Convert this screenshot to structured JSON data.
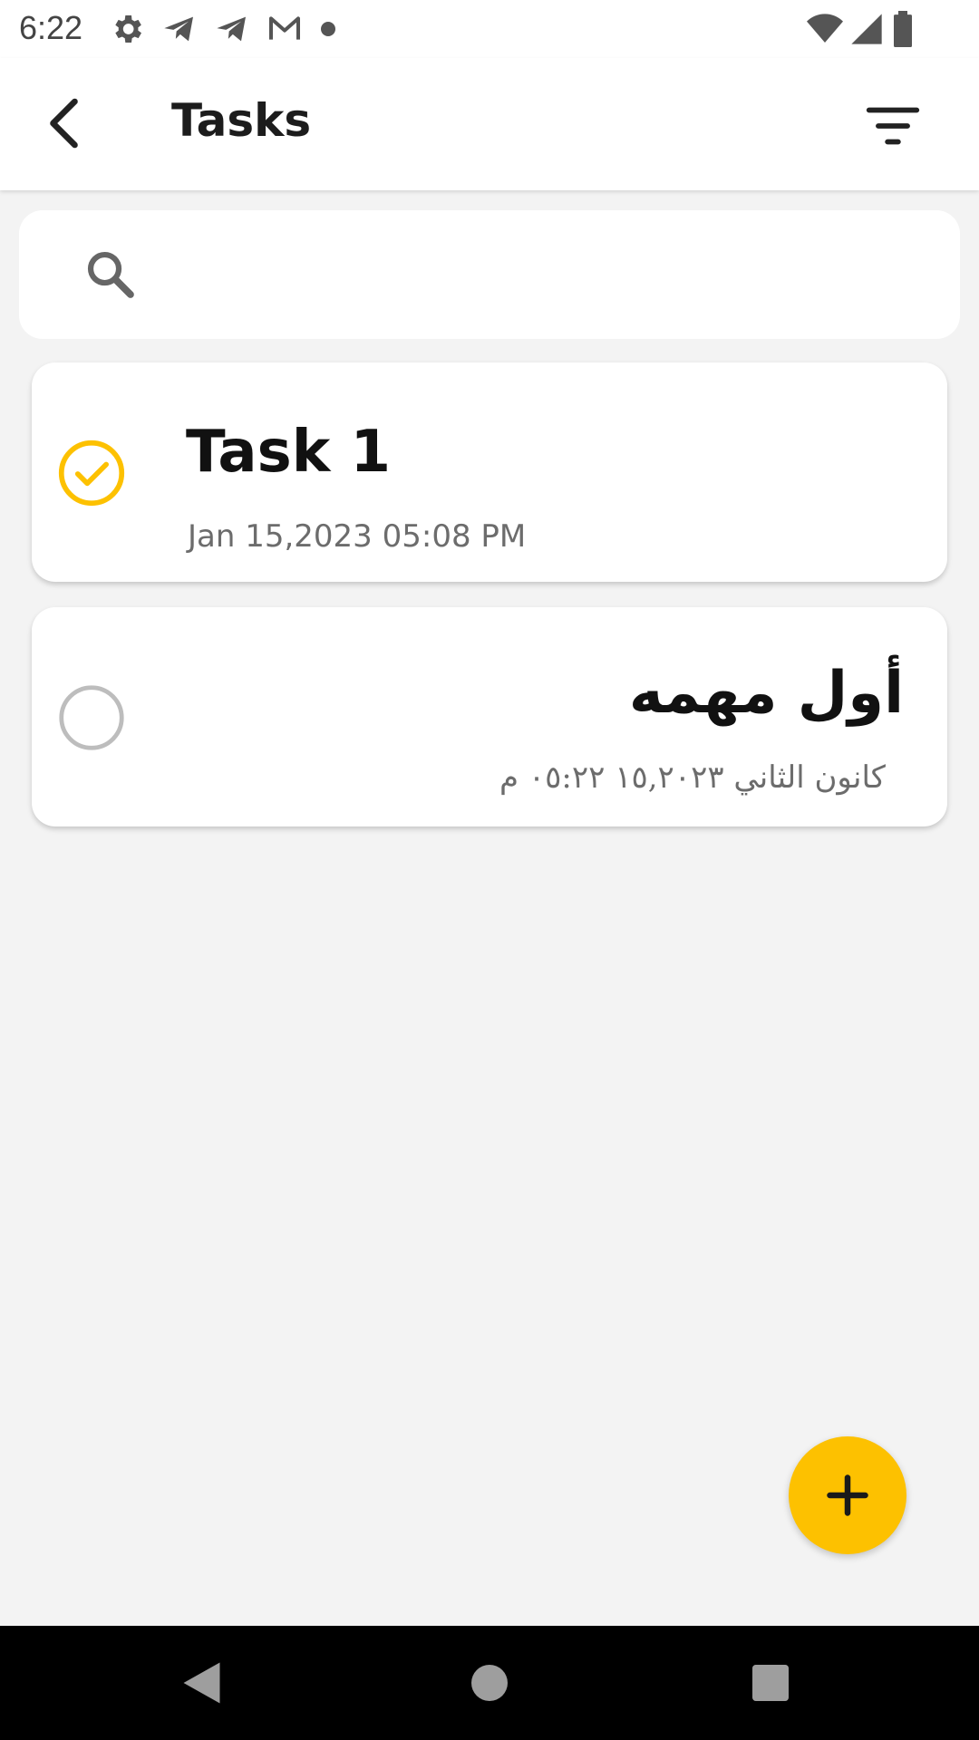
{
  "status_bar": {
    "time": "6:22",
    "left_icons": [
      "gear-icon",
      "telegram-icon",
      "telegram-icon",
      "gmail-icon",
      "dot-icon"
    ],
    "right_icons": [
      "wifi-icon",
      "cellular-icon",
      "battery-icon"
    ]
  },
  "app_bar": {
    "title": "Tasks",
    "back_icon": "chevron-left-icon",
    "filter_icon": "filter-icon"
  },
  "search": {
    "placeholder": "",
    "value": "",
    "icon": "search-icon"
  },
  "tasks": [
    {
      "title": "Task 1",
      "date": "Jan 15,2023  05:08 PM",
      "completed": true
    },
    {
      "title": "أول مهمه",
      "date": "كانون الثاني ١٥,٢٠٢٣  ٠٥:٢٢ م",
      "completed": false
    }
  ],
  "fab": {
    "icon": "plus-icon"
  },
  "colors": {
    "accent": "#fdc100",
    "background": "#f3f3f3",
    "card": "#ffffff",
    "text_primary": "#111111",
    "text_secondary": "#6c6c6c",
    "unchecked_circle": "#bdbdbd"
  },
  "nav_bar": {
    "back_icon": "triangle-back-icon",
    "home_icon": "circle-home-icon",
    "recents_icon": "square-recents-icon"
  }
}
